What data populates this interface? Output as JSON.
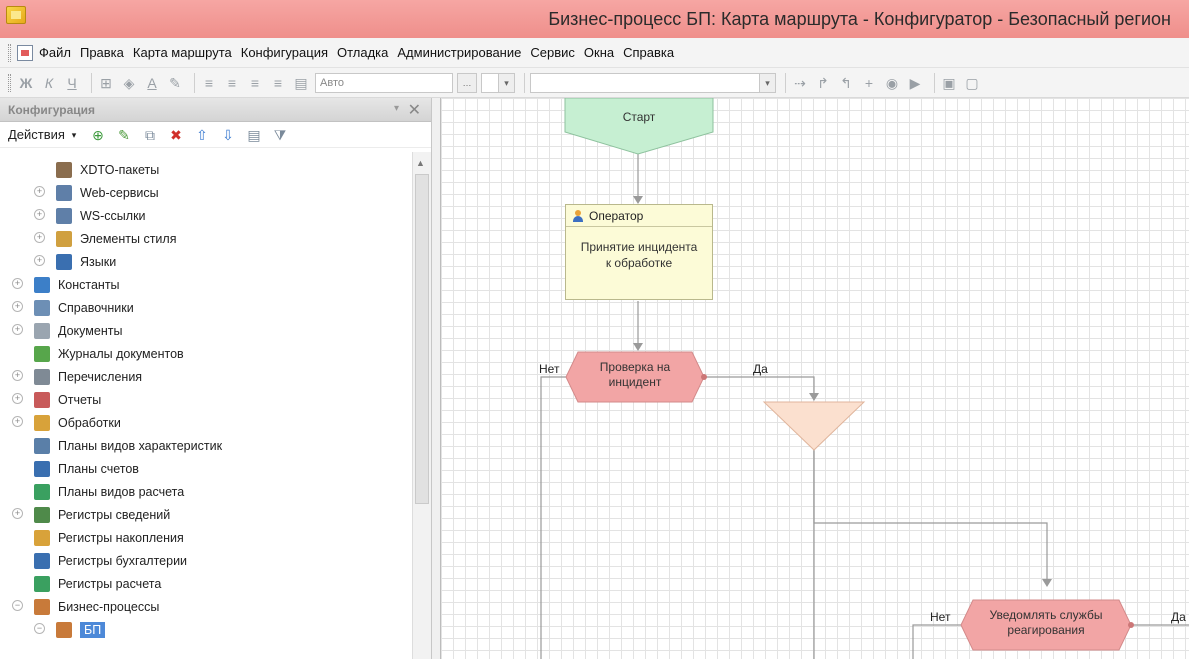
{
  "window": {
    "title": "Бизнес-процесс БП: Карта маршрута - Конфигуратор - Безопасный регион"
  },
  "menu": {
    "items": [
      "Файл",
      "Правка",
      "Карта маршрута",
      "Конфигурация",
      "Отладка",
      "Администрирование",
      "Сервис",
      "Окна",
      "Справка"
    ]
  },
  "toolbar": {
    "font_combo_value": "Авто",
    "icons": [
      "bold-icon",
      "italic-icon",
      "underline-icon",
      "border-icon",
      "fill-color-icon",
      "font-color-icon",
      "highlight-icon",
      "align-left-icon",
      "align-center-icon",
      "align-right-icon",
      "justify-icon",
      "page-icon"
    ]
  },
  "config_panel": {
    "title": "Конфигурация",
    "actions_label": "Действия",
    "tree": [
      {
        "label": "XDTO-пакеты",
        "level": 2,
        "expander": "",
        "icon": "xdto-icon",
        "color": "#8a6d4e"
      },
      {
        "label": "Web-сервисы",
        "level": 2,
        "expander": "+",
        "icon": "web-service-icon",
        "color": "#5f7fa8"
      },
      {
        "label": "WS-ссылки",
        "level": 2,
        "expander": "+",
        "icon": "ws-link-icon",
        "color": "#5f7fa8"
      },
      {
        "label": "Элементы стиля",
        "level": 2,
        "expander": "+",
        "icon": "style-icon",
        "color": "#d0a040"
      },
      {
        "label": "Языки",
        "level": 2,
        "expander": "+",
        "icon": "language-icon",
        "color": "#3a6fb0"
      },
      {
        "label": "Константы",
        "level": 1,
        "expander": "+",
        "icon": "constants-icon",
        "color": "#3c7fc8"
      },
      {
        "label": "Справочники",
        "level": 1,
        "expander": "+",
        "icon": "catalog-icon",
        "color": "#6d8fb5"
      },
      {
        "label": "Документы",
        "level": 1,
        "expander": "+",
        "icon": "document-icon",
        "color": "#9aa5b0"
      },
      {
        "label": "Журналы документов",
        "level": 1,
        "expander": "",
        "icon": "journal-icon",
        "color": "#57a64b"
      },
      {
        "label": "Перечисления",
        "level": 1,
        "expander": "+",
        "icon": "enum-icon",
        "color": "#7f8a95"
      },
      {
        "label": "Отчеты",
        "level": 1,
        "expander": "+",
        "icon": "report-icon",
        "color": "#c85a5a"
      },
      {
        "label": "Обработки",
        "level": 1,
        "expander": "+",
        "icon": "processing-icon",
        "color": "#d8a23a"
      },
      {
        "label": "Планы видов характеристик",
        "level": 1,
        "expander": "",
        "icon": "characteristic-plan-icon",
        "color": "#5a7fa8"
      },
      {
        "label": "Планы счетов",
        "level": 1,
        "expander": "",
        "icon": "accounts-plan-icon",
        "color": "#3a6fb0"
      },
      {
        "label": "Планы видов расчета",
        "level": 1,
        "expander": "",
        "icon": "calculation-plan-icon",
        "color": "#3aa060"
      },
      {
        "label": "Регистры сведений",
        "level": 1,
        "expander": "+",
        "icon": "info-register-icon",
        "color": "#4f8a4a"
      },
      {
        "label": "Регистры накопления",
        "level": 1,
        "expander": "",
        "icon": "accumulation-register-icon",
        "color": "#d8a23a"
      },
      {
        "label": "Регистры бухгалтерии",
        "level": 1,
        "expander": "",
        "icon": "accounting-register-icon",
        "color": "#3a6fb0"
      },
      {
        "label": "Регистры расчета",
        "level": 1,
        "expander": "",
        "icon": "calculation-register-icon",
        "color": "#3aa060"
      },
      {
        "label": "Бизнес-процессы",
        "level": 1,
        "expander": "−",
        "icon": "business-process-icon",
        "color": "#c87a3a"
      },
      {
        "label": "БП",
        "level": 2,
        "expander": "−",
        "icon": "business-process-icon",
        "color": "#c87a3a",
        "selected": true
      }
    ]
  },
  "diagram": {
    "start_label": "Старт",
    "operator_header": "Оператор",
    "operator_body_line1": "Принятие инцидента",
    "operator_body_line2": "к обработке",
    "check_line1": "Проверка на",
    "check_line2": "инцидент",
    "no_label_1": "Нет",
    "yes_label_1": "Да",
    "notify_line1": "Уведомлять службы",
    "notify_line2": "реагирования",
    "no_label_2": "Нет",
    "yes_label_2": "Да",
    "colors": {
      "start": "#c6efd2",
      "condition": "#f2a5a5",
      "merge": "#fbe0cf",
      "operator": "#fcfbd7",
      "line": "#9a9a9a"
    }
  }
}
